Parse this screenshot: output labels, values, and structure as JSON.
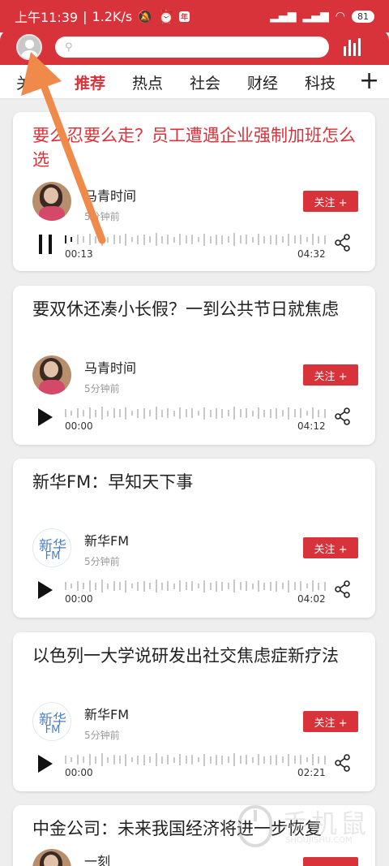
{
  "status_bar": {
    "time": "上午11:39",
    "speed": "1.2K/s",
    "alarm_badge": "年",
    "battery": "81"
  },
  "header": {
    "search_placeholder": ""
  },
  "tabs": [
    "关",
    "推荐",
    "热点",
    "社会",
    "财经",
    "科技"
  ],
  "active_tab": "推荐",
  "add_tab": "+",
  "cards": [
    {
      "title": "要么忍要么走？员工遭遇企业强制加班怎么选",
      "highlighted": true,
      "author": "马青时间",
      "time_ago": "5分钟前",
      "follow_label": "关注 +",
      "start": "00:13",
      "end": "04:32",
      "state": "playing",
      "progress": 0.05
    },
    {
      "title": "要双休还凑小长假？一到公共节日就焦虑",
      "highlighted": false,
      "author": "马青时间",
      "time_ago": "5分钟前",
      "follow_label": "关注 +",
      "start": "00:00",
      "end": "04:12",
      "state": "paused",
      "progress": 0
    },
    {
      "title": "新华FM：早知天下事",
      "highlighted": false,
      "author": "新华FM",
      "time_ago": "5分钟前",
      "follow_label": "关注 +",
      "start": "00:00",
      "end": "04:02",
      "state": "paused",
      "progress": 0
    },
    {
      "title": "以色列一大学说研发出社交焦虑症新疗法",
      "highlighted": false,
      "author": "新华FM",
      "time_ago": "5分钟前",
      "follow_label": "关注 +",
      "start": "00:00",
      "end": "02:21",
      "state": "paused",
      "progress": 0
    },
    {
      "title": "中金公司：未来我国经济将进一步恢复",
      "highlighted": false,
      "author": "一刻",
      "time_ago": "",
      "follow_label": "",
      "start": "",
      "end": "",
      "state": "paused",
      "progress": 0
    }
  ],
  "xinhua_logo": {
    "top": "新华",
    "bottom": "FM"
  },
  "watermark": {
    "main": "手机鼠",
    "sub": "SHOUJISHU.COM"
  },
  "colors": {
    "brand": "#d8323a",
    "arrow": "#f08a4b"
  }
}
